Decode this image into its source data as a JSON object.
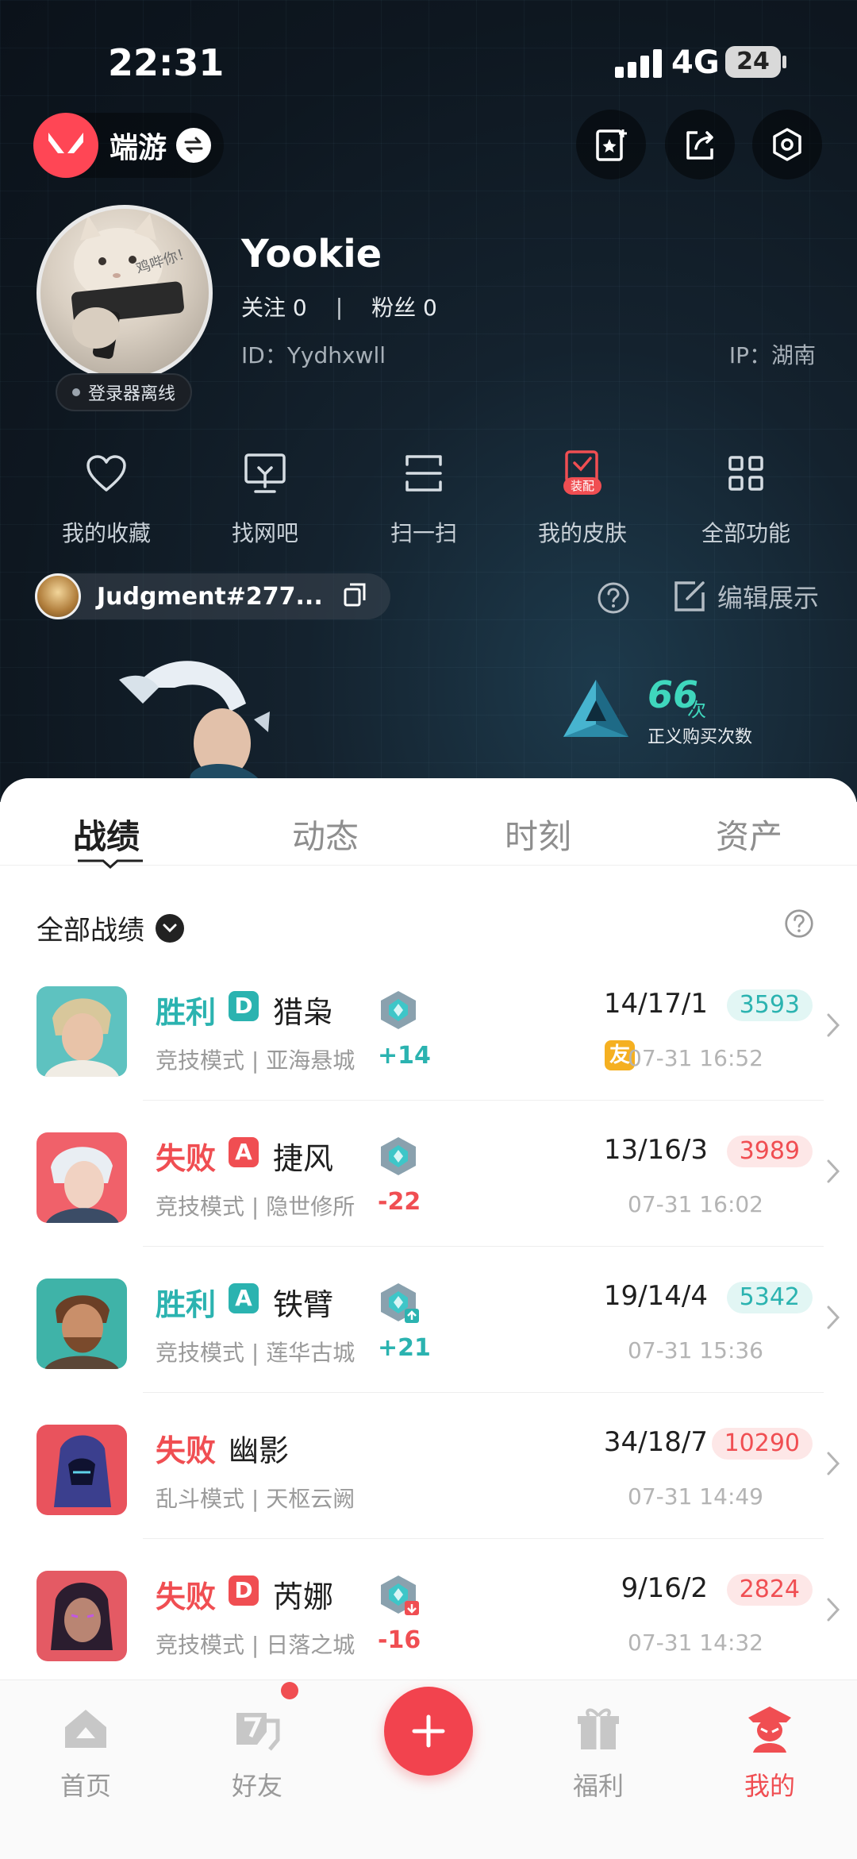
{
  "status_bar": {
    "time": "22:31",
    "network": "4G",
    "battery": "24"
  },
  "header": {
    "brand_label": "端游"
  },
  "profile": {
    "avatar_caption": "鸡哔你！",
    "online_status": "登录器离线",
    "username": "Yookie",
    "following_label": "关注 0",
    "separator": "|",
    "followers_label": "粉丝 0",
    "user_id": "ID：Yydhxwll",
    "ip": "IP：湖南"
  },
  "quick_actions": [
    {
      "label": "我的收藏",
      "icon": "heart-icon"
    },
    {
      "label": "找网吧",
      "icon": "monitor-icon"
    },
    {
      "label": "扫一扫",
      "icon": "scan-icon"
    },
    {
      "label": "我的皮肤",
      "icon": "skin-icon",
      "badge": "装配"
    },
    {
      "label": "全部功能",
      "icon": "grid-icon"
    }
  ],
  "game_account": {
    "name": "Judgment#277...",
    "edit_label": "编辑展示"
  },
  "stat": {
    "value": "66",
    "unit": "次",
    "label": "正义购买次数"
  },
  "tabs": [
    {
      "label": "战绩",
      "active": true
    },
    {
      "label": "动态",
      "active": false
    },
    {
      "label": "时刻",
      "active": false
    },
    {
      "label": "资产",
      "active": false
    }
  ],
  "filter": {
    "label": "全部战绩"
  },
  "matches": [
    {
      "result": "胜利",
      "outcome": "win",
      "rank_grade": "D",
      "agent": "猎枭",
      "mode_map": "竞技模式 | 亚海悬城",
      "rr": "+14",
      "rr_dir": "up",
      "kda": "14/17/1",
      "score": "3593",
      "friend_tag": "友",
      "time": "07-31 16:52"
    },
    {
      "result": "失败",
      "outcome": "lose",
      "rank_grade": "A",
      "agent": "捷风",
      "mode_map": "竞技模式 | 隐世修所",
      "rr": "-22",
      "rr_dir": "down",
      "kda": "13/16/3",
      "score": "3989",
      "friend_tag": "",
      "time": "07-31 16:02"
    },
    {
      "result": "胜利",
      "outcome": "win",
      "rank_grade": "A",
      "agent": "铁臂",
      "mode_map": "竞技模式 | 莲华古城",
      "rr": "+21",
      "rr_dir": "up",
      "kda": "19/14/4",
      "score": "5342",
      "friend_tag": "",
      "time": "07-31 15:36"
    },
    {
      "result": "失败",
      "outcome": "lose",
      "rank_grade": "",
      "agent": "幽影",
      "mode_map": "乱斗模式 | 天枢云阙",
      "rr": "",
      "rr_dir": "",
      "kda": "34/18/7",
      "score": "10290",
      "friend_tag": "",
      "time": "07-31 14:49"
    },
    {
      "result": "失败",
      "outcome": "lose",
      "rank_grade": "D",
      "agent": "芮娜",
      "mode_map": "竞技模式 | 日落之城",
      "rr": "-16",
      "rr_dir": "down",
      "kda": "9/16/2",
      "score": "2824",
      "friend_tag": "",
      "time": "07-31 14:32"
    }
  ],
  "bottom_nav": [
    {
      "label": "首页",
      "active": false
    },
    {
      "label": "好友",
      "active": false
    },
    {
      "label": "福利",
      "active": false
    },
    {
      "label": "我的",
      "active": true
    }
  ],
  "colors": {
    "accent": "#f04e52",
    "win": "#2bb3b0",
    "lose": "#f04e52",
    "teal_stat": "#3fd7bd"
  }
}
